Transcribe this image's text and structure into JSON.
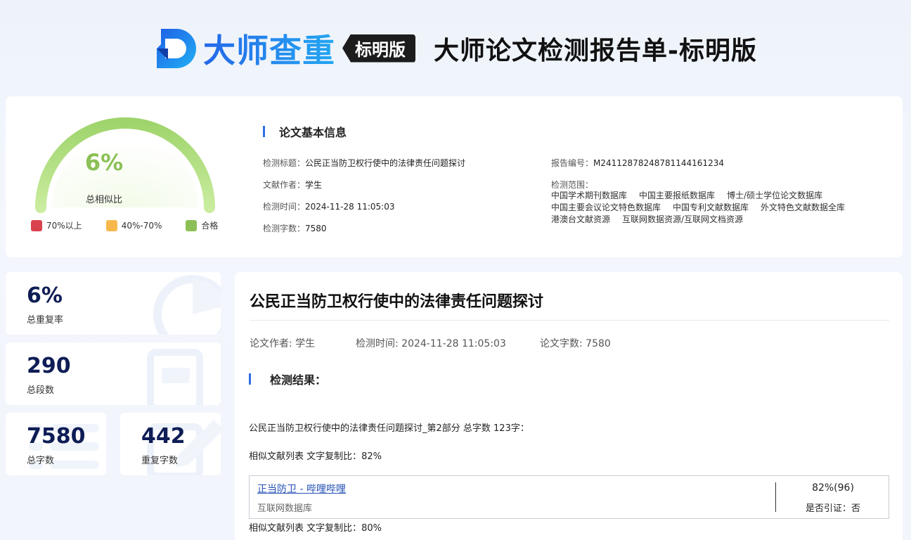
{
  "header": {
    "brand_name": "大师查重",
    "brand_badge": "标明版",
    "report_title": "大师论文检测报告单-标明版"
  },
  "gauge": {
    "percent_text": "6%",
    "value": 0.06,
    "label": "总相似比",
    "legend": [
      {
        "label": "70%以上",
        "color": "#d9434e"
      },
      {
        "label": "40%-70%",
        "color": "#f7b84b"
      },
      {
        "label": "合格",
        "color": "#8cc056"
      }
    ]
  },
  "info": {
    "heading": "论文基本信息",
    "fields": {
      "title_label": "检测标题：",
      "title_value": "公民正当防卫权行使中的法律责任问题探讨",
      "author_label": "文献作者：",
      "author_value": "学生",
      "time_label": "检测时间：",
      "time_value": "2024-11-28 11:05:03",
      "words_label": "检测字数：",
      "words_value": "7580",
      "report_no_label": "报告编号：",
      "report_no_value": "M2411287824878114416123‌4",
      "scope_label": "检测范围："
    },
    "databases": [
      "中国学术期刊数据库",
      "中国主要报纸数据库",
      "博士/硕士学位论文数据库",
      "中国主要会议论文特色数据库",
      "中国专利文献数据库",
      "外文特色文献数据全库",
      "港澳台文献资源",
      "互联网数据资源/互联网文档资源"
    ]
  },
  "stats": {
    "repeat_rate": {
      "value": "6%",
      "label": "总重复率"
    },
    "paragraphs": {
      "value": "290",
      "label": "总段数"
    },
    "total_words": {
      "value": "7580",
      "label": "总字数"
    },
    "repeat_words": {
      "value": "442",
      "label": "重复字数"
    }
  },
  "main": {
    "doc_title": "公民正当防卫权行使中的法律责任问题探讨",
    "meta_author": "论文作者: 学生",
    "meta_time": "检测时间: 2024-11-28 11:05:03",
    "meta_words": "论文字数: 7580",
    "result_heading": "检测结果：",
    "section_line": "公民正当防卫权行使中的法律责任问题探讨_第2部分 总字数 123字：",
    "similar_list_1": "相似文献列表 文字复制比：82%",
    "similar_item": {
      "title": "正当防卫 - 哔哩哔哩",
      "source": "互联网数据库",
      "percent": "82%(96)",
      "cited": "是否引证：否"
    },
    "similar_list_2": "相似文献列表 文字复制比：80%"
  },
  "colors": {
    "accent_blue": "#2f6ee6",
    "gauge_green": "#8cc056",
    "stat_number": "#0e1d55"
  }
}
